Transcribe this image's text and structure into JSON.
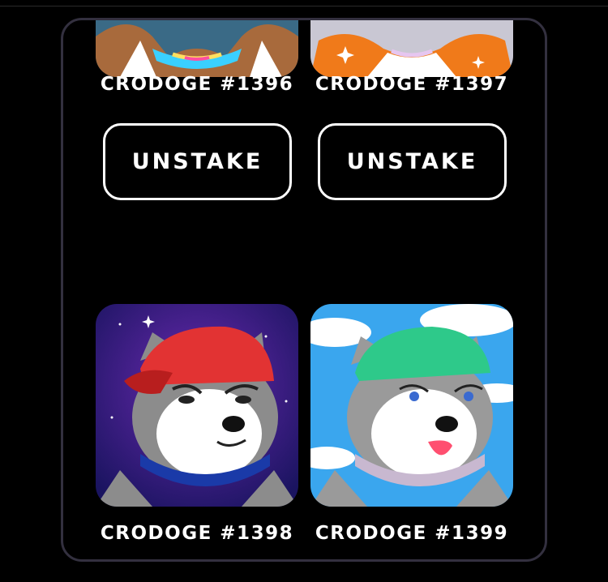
{
  "cards": [
    {
      "name": "CRODOGE #1396",
      "button": "UNSTAKE",
      "bg": "#3a6a86",
      "fur": "#a86a3c",
      "accent": "#e8c07a"
    },
    {
      "name": "CRODOGE #1397",
      "button": "UNSTAKE",
      "bg": "#c9c7d3",
      "fur": "#f07a1a",
      "accent": "#ffffff"
    },
    {
      "name": "CRODOGE #1398",
      "bg": "#3a1a7a",
      "fur": "#8c8c8c",
      "hat": "#e23333",
      "collar": "#1a3aa8"
    },
    {
      "name": "CRODOGE #1399",
      "bg": "#3aa6ee",
      "fur": "#9a9a9a",
      "hat": "#2ec98a",
      "collar": "#c8b8d0"
    }
  ],
  "colors": {
    "panel_border": "#33303f",
    "button_border": "#ffffff",
    "text": "#ffffff"
  }
}
